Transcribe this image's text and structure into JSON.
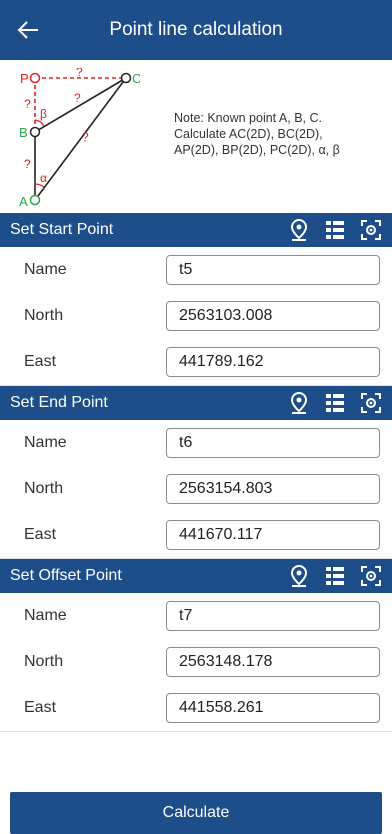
{
  "header": {
    "title": "Point line calculation",
    "back_icon": "arrow-left-icon"
  },
  "diagram": {
    "labels": {
      "P": "P",
      "C": "C",
      "B": "B",
      "A": "A",
      "alpha": "α",
      "beta": "β",
      "unknown": "?"
    },
    "colors": {
      "line_red": "#e52222",
      "line_black": "#222222",
      "point_green": "#2aa84a"
    }
  },
  "note": {
    "line1": "Note: Known point A, B, C.",
    "line2": "Calculate AC(2D), BC(2D),",
    "line3": "AP(2D), BP(2D), PC(2D), α, β"
  },
  "sections": {
    "start": {
      "label": "Set Start Point",
      "name_label": "Name",
      "name_value": "t5",
      "north_label": "North",
      "north_value": "2563103.008",
      "east_label": "East",
      "east_value": "441789.162"
    },
    "end": {
      "label": "Set End Point",
      "name_label": "Name",
      "name_value": "t6",
      "north_label": "North",
      "north_value": "2563154.803",
      "east_label": "East",
      "east_value": "441670.117"
    },
    "offset": {
      "label": "Set Offset Point",
      "name_label": "Name",
      "name_value": "t7",
      "north_label": "North",
      "north_value": "2563148.178",
      "east_label": "East",
      "east_value": "441558.261"
    }
  },
  "section_icons": [
    "location-pin-icon",
    "list-icon",
    "scan-icon"
  ],
  "calculate_label": "Calculate",
  "theme": {
    "primary": "#1d4e89"
  }
}
